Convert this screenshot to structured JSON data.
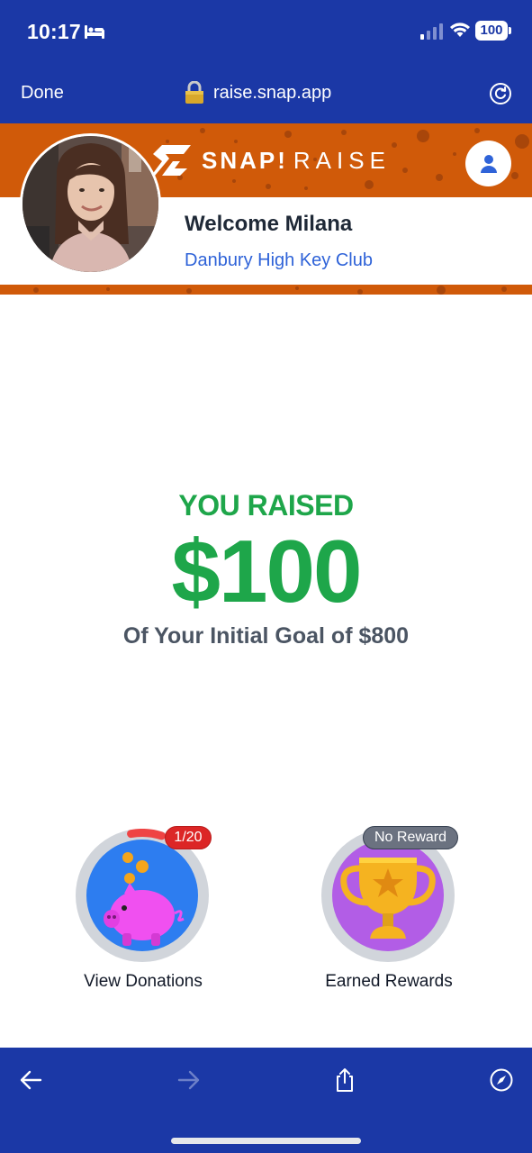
{
  "status_bar": {
    "time": "10:17",
    "battery": "100",
    "icons": [
      "bed-icon",
      "signal-icon",
      "wifi-icon",
      "battery-icon"
    ]
  },
  "browser": {
    "done_label": "Done",
    "url": "raise.snap.app",
    "icons": [
      "lock-icon",
      "reload-icon"
    ]
  },
  "header": {
    "logo_word_1": "SNAP!",
    "logo_word_2": "RAISE",
    "welcome": "Welcome Milana",
    "organization": "Danbury High Key Club",
    "icons": [
      "snap-logo-icon",
      "profile-icon",
      "avatar"
    ]
  },
  "summary": {
    "label": "YOU RAISED",
    "amount": "$100",
    "goal_text": "Of Your Initial Goal of $800"
  },
  "tiles": [
    {
      "label": "View Donations",
      "badge": "1/20",
      "icon": "piggy-bank-icon",
      "progress": 0.05
    },
    {
      "label": "Earned Rewards",
      "badge": "No Reward",
      "icon": "trophy-icon"
    }
  ],
  "toolbar": {
    "icons": [
      "back-arrow-icon",
      "forward-arrow-icon",
      "share-icon",
      "compass-icon"
    ]
  },
  "colors": {
    "chrome_blue": "#1b38a6",
    "brand_orange": "#d05a09",
    "raised_green": "#1ea64a",
    "link_blue": "#2f63d8",
    "badge_red": "#dc2626"
  }
}
